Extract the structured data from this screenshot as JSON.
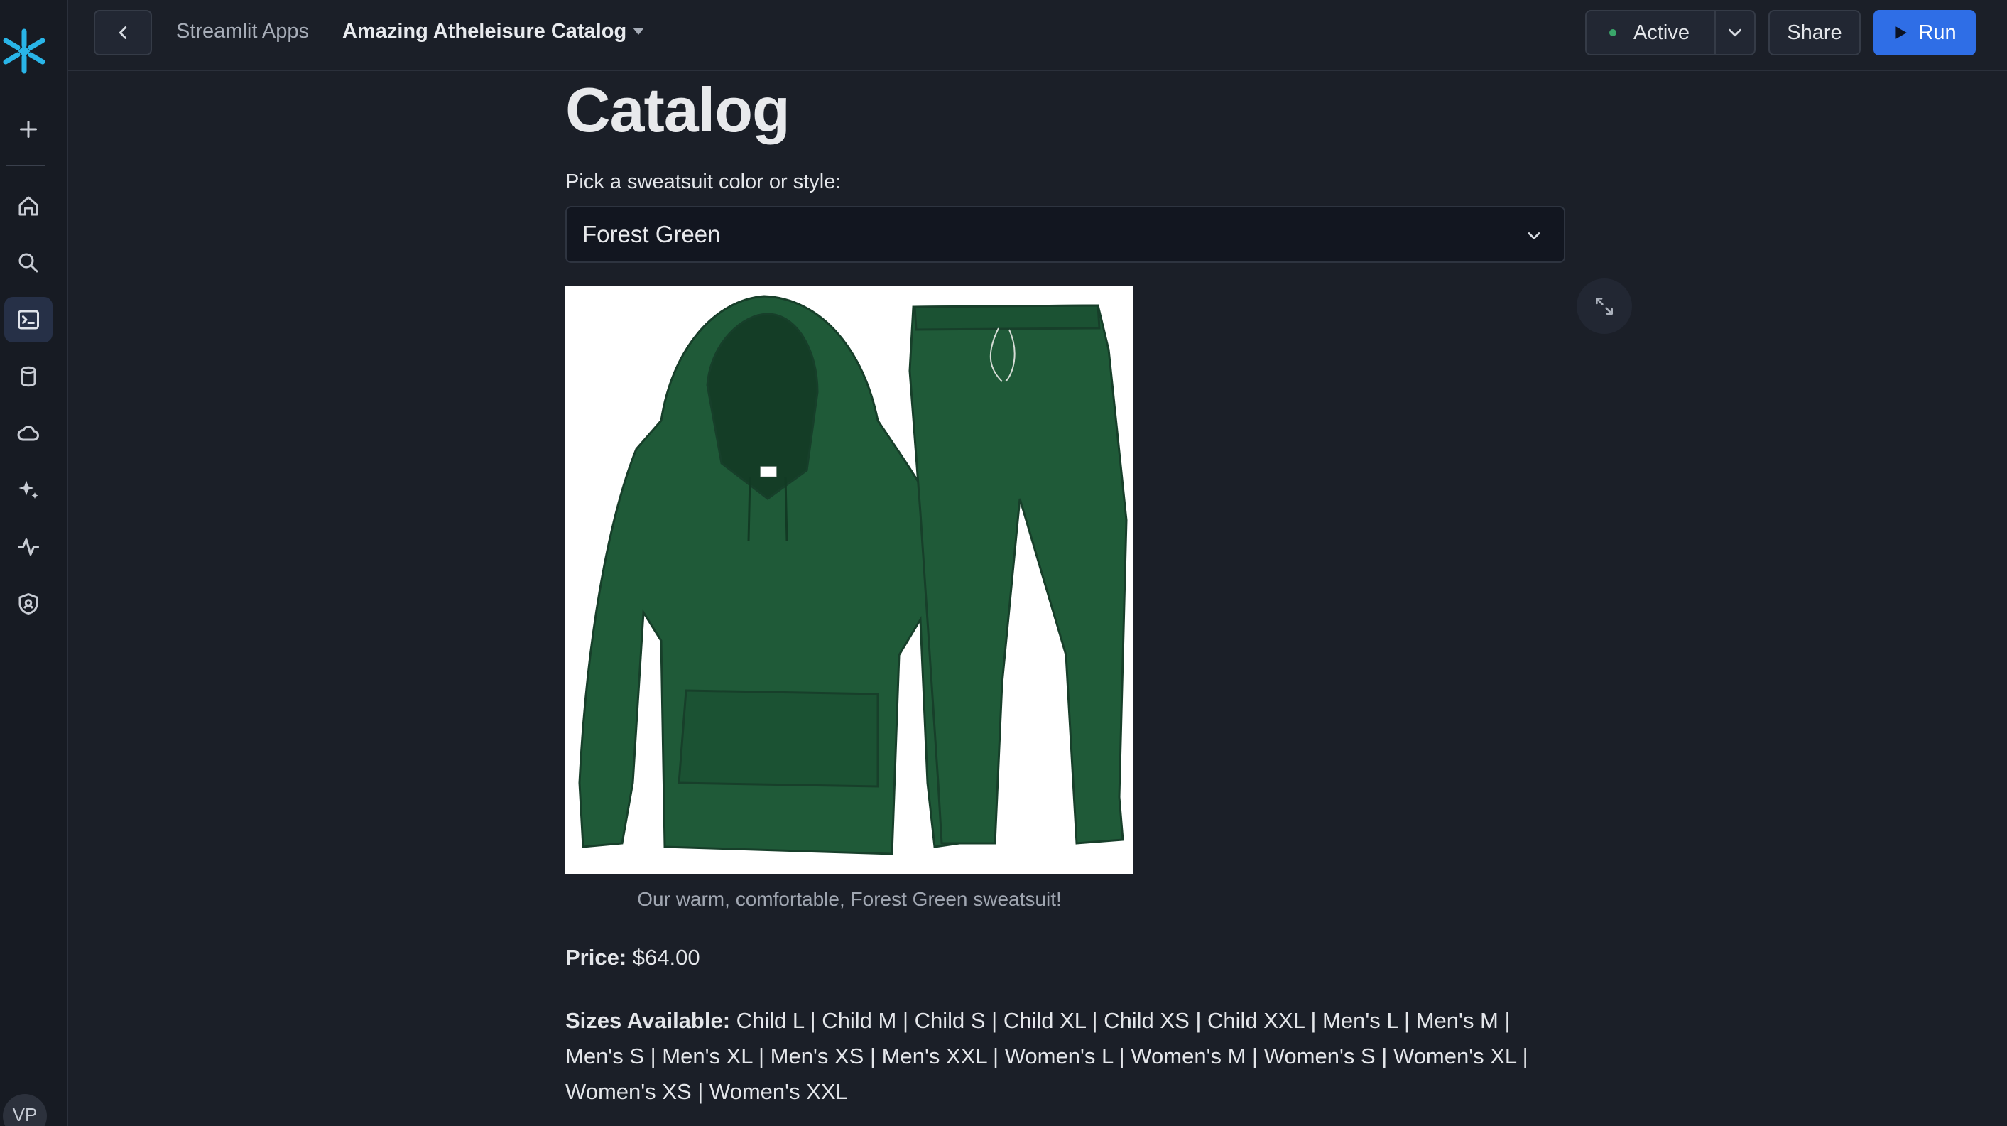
{
  "topbar": {
    "breadcrumb": "Streamlit Apps",
    "app_title": "Amazing Atheleisure Catalog",
    "status": "Active",
    "share_label": "Share",
    "run_label": "Run"
  },
  "sidebar": {
    "items": [
      {
        "icon": "plus-icon"
      },
      {
        "icon": "home-icon"
      },
      {
        "icon": "search-icon"
      },
      {
        "icon": "terminal-icon",
        "active": true
      },
      {
        "icon": "database-icon"
      },
      {
        "icon": "cloud-icon"
      },
      {
        "icon": "sparkle-icon"
      },
      {
        "icon": "activity-icon"
      },
      {
        "icon": "shield-icon"
      }
    ],
    "avatar": "VP"
  },
  "main": {
    "title": "Catalog",
    "select_label": "Pick a sweatsuit color or style:",
    "select_value": "Forest Green",
    "caption": "Our warm, comfortable, Forest Green sweatsuit!",
    "price_label": "Price:",
    "price_value": "$64.00",
    "sizes_label": "Sizes Available:",
    "sizes_value": "Child L | Child M | Child S | Child XL | Child XS | Child XXL | Men's L | Men's M | Men's S | Men's XL | Men's XS | Men's XXL | Women's L | Women's M | Women's S | Women's XL | Women's XS | Women's XXL"
  },
  "colors": {
    "accent": "#2f6ee6",
    "snowflake": "#29b5e8",
    "sweatsuit": "#1f5a38",
    "background": "#1b1f28"
  }
}
